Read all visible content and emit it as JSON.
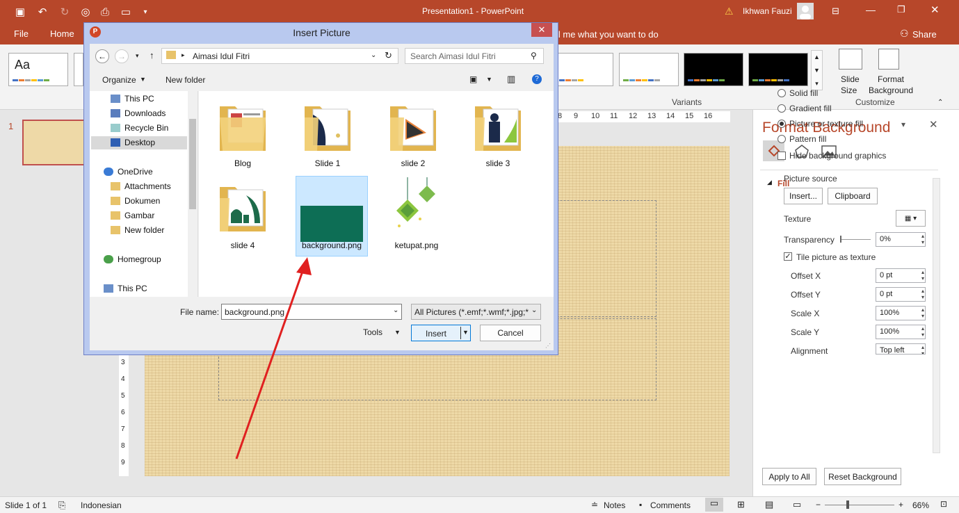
{
  "window": {
    "title": "Presentation1  -  PowerPoint",
    "user": "Ikhwan Fauzi"
  },
  "tabs": [
    "File",
    "Home"
  ],
  "tell_me": "ll me what you want to do",
  "share_label": "Share",
  "ribbon": {
    "theme_aa": "Aa",
    "variants_label": "Variants",
    "slide_size": "Slide\nSize",
    "format_background": "Format\nBackground",
    "customize_label": "Customize",
    "ruler_numbers": [
      "8",
      "9",
      "10",
      "11",
      "12",
      "13",
      "14",
      "15",
      "16"
    ],
    "vruler_numbers": [
      "3",
      "4",
      "5",
      "6",
      "7",
      "8",
      "9"
    ]
  },
  "thumb_number": "1",
  "dialog": {
    "title": "Insert Picture",
    "breadcrumb": "Aimasi Idul Fitri",
    "search_placeholder": "Search Aimasi Idul Fitri",
    "organize": "Organize",
    "new_folder": "New folder",
    "nav": [
      "This PC",
      "Downloads",
      "Recycle Bin",
      "Desktop",
      "OneDrive",
      "Attachments",
      "Dokumen",
      "Gambar",
      "New folder",
      "Homegroup",
      "This PC"
    ],
    "files": [
      "Blog",
      "Slide 1",
      "slide 2",
      "slide 3",
      "slide 4",
      "background.png",
      "ketupat.png"
    ],
    "file_name_label": "File name:",
    "file_name_value": "background.png",
    "filter": "All Pictures (*.emf;*.wmf;*.jpg;*",
    "tools": "Tools",
    "insert": "Insert",
    "cancel": "Cancel"
  },
  "format_pane": {
    "title": "Format Background",
    "fill_header": "Fill",
    "options": [
      "Solid fill",
      "Gradient fill",
      "Picture or texture fill",
      "Pattern fill"
    ],
    "hide_graphics": "Hide background graphics",
    "picture_source": "Picture source",
    "insert_btn": "Insert...",
    "clipboard_btn": "Clipboard",
    "texture": "Texture",
    "transparency": "Transparency",
    "transparency_value": "0%",
    "tile": "Tile picture as texture",
    "offset_x": "Offset X",
    "offset_x_value": "0 pt",
    "offset_y": "Offset Y",
    "offset_y_value": "0 pt",
    "scale_x": "Scale X",
    "scale_x_value": "100%",
    "scale_y": "Scale Y",
    "scale_y_value": "100%",
    "alignment": "Alignment",
    "alignment_value": "Top left",
    "apply_all": "Apply to All",
    "reset": "Reset Background"
  },
  "status": {
    "slide": "Slide 1 of 1",
    "language": "Indonesian",
    "notes": "Notes",
    "comments": "Comments",
    "zoom": "66%"
  },
  "colors": {
    "accent": "#b7472a",
    "dialog_frame": "#b9c9ef",
    "pane_title": "#b7472a",
    "selection": "#cce8ff",
    "arrow": "#e02020"
  }
}
